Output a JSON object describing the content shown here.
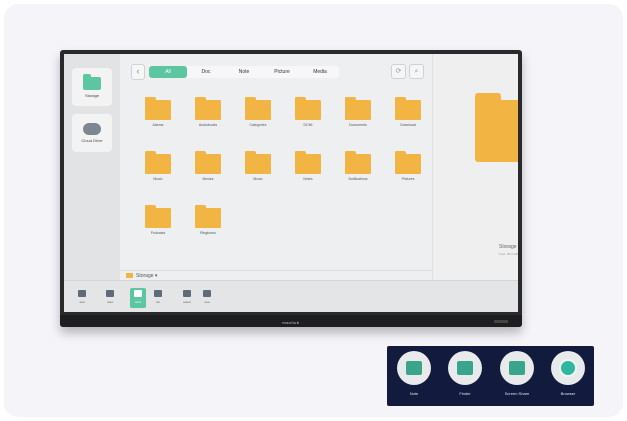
{
  "sidebar": {
    "items": [
      {
        "label": "Storage",
        "icon": "folder-icon"
      },
      {
        "label": "Cloud Drive",
        "icon": "cloud-icon"
      }
    ]
  },
  "tabs": [
    "All",
    "Doc",
    "Note",
    "Picture",
    "Media"
  ],
  "active_tab": "All",
  "folders": [
    "Alarms",
    "Audiobooks",
    "Categories",
    "DCIM",
    "Documents",
    "Download",
    "Music",
    "Movies",
    "Music",
    "Notes",
    "Notifications",
    "Pictures",
    "Podcasts",
    "Ringtones"
  ],
  "path": {
    "label": "Storage",
    "chevron": "▾"
  },
  "preview": {
    "title": "Storage",
    "subtitle": "Free: 98.0 GB"
  },
  "toolbar": [
    {
      "label": "add",
      "icon": "folder-icon",
      "active": false
    },
    {
      "label": "load",
      "icon": "doc-icon",
      "active": false
    },
    {
      "label": "Grid",
      "icon": "grid-icon",
      "active": true
    },
    {
      "label": "list",
      "icon": "list-icon",
      "active": false
    },
    {
      "label": "select",
      "icon": "select-icon",
      "active": false
    },
    {
      "label": "new",
      "icon": "new-folder-icon",
      "active": false
    }
  ],
  "tv_brand": "maxhub",
  "dock": [
    {
      "label": "Note",
      "icon": "note-icon"
    },
    {
      "label": "Finder",
      "icon": "finder-icon"
    },
    {
      "label": "Screen Share",
      "icon": "screen-share-icon"
    },
    {
      "label": "Browser",
      "icon": "browser-icon"
    }
  ],
  "colors": {
    "accent": "#5cc6a0",
    "folder": "#f2b443",
    "dock_bg": "#121a3e"
  }
}
